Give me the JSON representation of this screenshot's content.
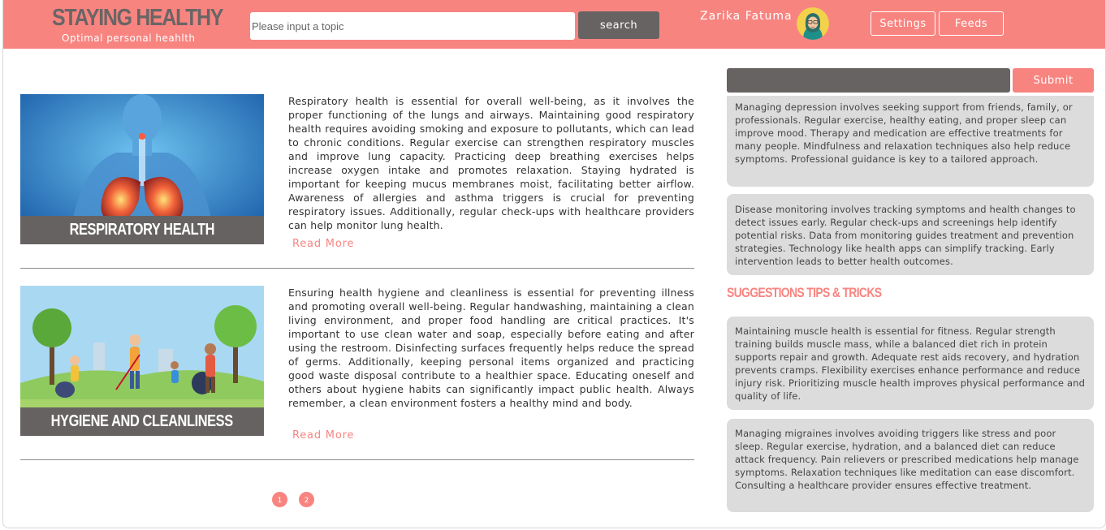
{
  "header": {
    "brand_title": "STAYING HEALTHY",
    "brand_subtitle": "Optimal personal heahlth",
    "search_placeholder": "Please input a topic",
    "search_button": "search",
    "username": "Zarika Fatuma",
    "settings_button": "Settings",
    "feeds_button": "Feeds"
  },
  "articles": [
    {
      "caption": "RESPIRATORY HEALTH",
      "text": "Respiratory health is essential for overall well-being, as it involves the proper functioning of the lungs and airways. Maintaining good respiratory health requires avoiding smoking and exposure to pollutants, which can lead to chronic conditions. Regular exercise can strengthen respiratory muscles and improve lung capacity. Practicing deep breathing exercises helps increase oxygen intake and promotes relaxation. Staying hydrated is important for keeping mucus membranes moist, facilitating better airflow. Awareness of allergies and asthma triggers is crucial for preventing respiratory issues. Additionally, regular check-ups with healthcare providers can help monitor lung health.",
      "read_more": "Read More"
    },
    {
      "caption": "HYGIENE AND CLEANLINESS",
      "text": "Ensuring health hygiene and cleanliness is essential for preventing illness and promoting overall well-being. Regular handwashing, maintaining a clean living environment, and proper food handling are critical practices. It's important to use clean water and soap, especially before eating and after using the restroom. Disinfecting surfaces frequently helps reduce the spread of germs. Additionally, keeping personal items organized and practicing good waste disposal contribute to a healthier space. Educating oneself and others about hygiene habits can significantly impact public health. Always remember, a clean environment fosters a healthy mind and body.",
      "read_more": "Read More"
    }
  ],
  "pagination": [
    "1",
    "2"
  ],
  "sidebar": {
    "submit_button": "Submit",
    "cards_top": [
      "Managing depression involves seeking support from friends, family, or professionals. Regular exercise, healthy eating, and proper sleep can improve mood. Therapy and medication are effective treatments for many people. Mindfulness and relaxation techniques also help reduce symptoms. Professional guidance is key to a tailored approach.",
      "Disease monitoring involves tracking symptoms and health changes to detect issues early. Regular check-ups and screenings help identify potential risks. Data from monitoring guides treatment and prevention strategies. Technology like health apps can simplify tracking. Early intervention leads to better health outcomes."
    ],
    "suggestions_heading": "SUGGESTIONS TIPS & TRICKS",
    "cards_bottom": [
      "Maintaining muscle health is essential for fitness. Regular strength training builds muscle mass, while a balanced diet rich in protein supports repair and growth. Adequate rest aids recovery, and hydration prevents cramps. Flexibility exercises enhance performance and reduce injury risk. Prioritizing muscle health improves physical performance and quality of life.",
      "Managing migraines involves avoiding triggers like stress and poor sleep. Regular exercise, hydration, and a balanced diet can reduce attack frequency. Pain relievers or prescribed medications help manage symptoms. Relaxation techniques like meditation can ease discomfort. Consulting a healthcare provider ensures effective treatment."
    ]
  },
  "colors": {
    "accent": "#f88480",
    "dark": "#686363",
    "card": "#dcdcdc"
  },
  "icons": [
    "user-avatar-icon"
  ]
}
